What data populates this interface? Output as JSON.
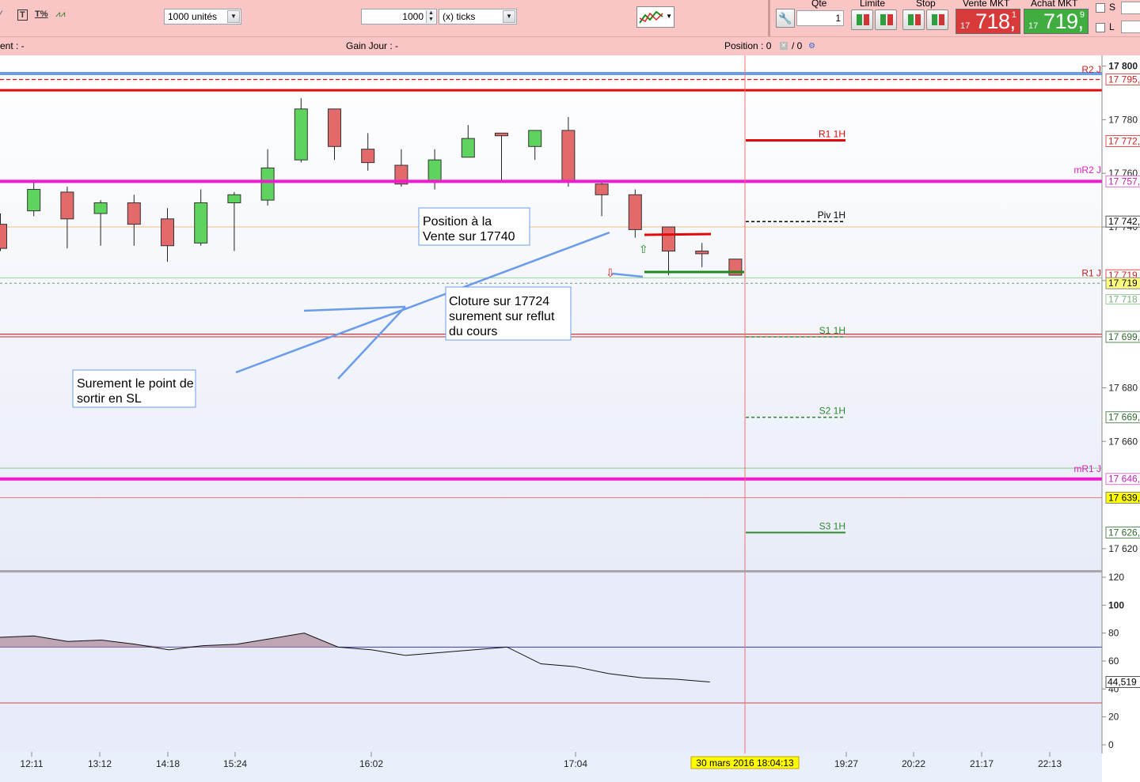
{
  "toolbar": {
    "quantity_select": "1000 unités",
    "ticks_value": "1000",
    "ticks_unit": "(x) ticks",
    "qte_label": "Qte",
    "qte_value": "1",
    "limite_label": "Limite",
    "stop_label": "Stop",
    "vente_label": "Vente MKT",
    "vente_prefix": "17",
    "vente_price": "718,",
    "vente_decimal": "1",
    "achat_label": "Achat MKT",
    "achat_prefix": "17",
    "achat_price": "719,",
    "achat_decimal": "9",
    "s_label": "S",
    "l_label": "L"
  },
  "infobar": {
    "left": "ent : -",
    "gain": "Gain Jour : -",
    "position": "Position : 0",
    "position2": "/ 0"
  },
  "colors": {
    "bull": "#5ed45e",
    "bear": "#e26a6a",
    "magenta": "#ee1bd0",
    "red": "#e00a0a",
    "blue": "#6b9cec",
    "green": "#2e8a2e"
  },
  "chart_data": {
    "type": "candlestick",
    "price_axis": {
      "ylim": [
        17612,
        17804
      ],
      "ticks": [
        "17 800",
        "17 780",
        "17 760",
        "17 740",
        "17 720",
        "17 680",
        "17 660",
        "17 620"
      ]
    },
    "time_axis": {
      "ticks": [
        "12:11",
        "13:12",
        "14:18",
        "15:24",
        "16:02",
        "17:04",
        "19:27",
        "20:22",
        "21:17",
        "22:13"
      ],
      "cursor_label": "30 mars 2016 18:04:13"
    },
    "candles": [
      {
        "o": 17741,
        "c": 17732,
        "h": 17745,
        "l": 17731
      },
      {
        "o": 17746,
        "c": 17754,
        "h": 17757,
        "l": 17744
      },
      {
        "o": 17753,
        "c": 17743,
        "h": 17755,
        "l": 17732
      },
      {
        "o": 17745,
        "c": 17749,
        "h": 17750,
        "l": 17733
      },
      {
        "o": 17749,
        "c": 17741,
        "h": 17752,
        "l": 17733
      },
      {
        "o": 17743,
        "c": 17733,
        "h": 17747,
        "l": 17727
      },
      {
        "o": 17734,
        "c": 17749,
        "h": 17754,
        "l": 17733
      },
      {
        "o": 17749,
        "c": 17752,
        "h": 17753,
        "l": 17731
      },
      {
        "o": 17750,
        "c": 17762,
        "h": 17769,
        "l": 17748
      },
      {
        "o": 17765,
        "c": 17784,
        "h": 17788,
        "l": 17764
      },
      {
        "o": 17784,
        "c": 17770,
        "h": 17784,
        "l": 17765
      },
      {
        "o": 17769,
        "c": 17764,
        "h": 17775,
        "l": 17761
      },
      {
        "o": 17763,
        "c": 17756,
        "h": 17769,
        "l": 17755
      },
      {
        "o": 17757,
        "c": 17765,
        "h": 17769,
        "l": 17754
      },
      {
        "o": 17766,
        "c": 17773,
        "h": 17778,
        "l": 17766
      },
      {
        "o": 17775,
        "c": 17774,
        "h": 17775,
        "l": 17757
      },
      {
        "o": 17770,
        "c": 17776,
        "h": 17776,
        "l": 17765
      },
      {
        "o": 17776,
        "c": 17757,
        "h": 17781,
        "l": 17755
      },
      {
        "o": 17756,
        "c": 17752,
        "h": 17757,
        "l": 17744
      },
      {
        "o": 17752,
        "c": 17739,
        "h": 17754,
        "l": 17736
      },
      {
        "o": 17740,
        "c": 17731,
        "h": 17740,
        "l": 17722
      },
      {
        "o": 17731,
        "c": 17730,
        "h": 17734,
        "l": 17725
      },
      {
        "o": 17728,
        "c": 17722,
        "h": 17728,
        "l": 17722
      }
    ],
    "levels": [
      {
        "label": "R2 J",
        "value": 17795,
        "tag": "17 795,"
      },
      {
        "label": "mR2 J",
        "value": 17757,
        "tag": "17 757,"
      },
      {
        "label": "R1 J",
        "value": 17719,
        "tag": "17 719,"
      },
      {
        "label": "mR1 J",
        "value": 17646,
        "tag": "17 646,"
      },
      {
        "label": "",
        "value": 17639,
        "tag": "17 639,"
      },
      {
        "label": "",
        "value": 17699,
        "tag": "17 699,"
      },
      {
        "label": "",
        "value": 17742,
        "tag": "17 742,"
      },
      {
        "label": "",
        "value": 17772,
        "tag": "17 772,"
      },
      {
        "label": "",
        "value": 17669,
        "tag": "17 669,"
      },
      {
        "label": "",
        "value": 17626,
        "tag": "17 626,"
      }
    ],
    "pivots": [
      {
        "label": "R1 1H",
        "value": 17772
      },
      {
        "label": "Piv 1H",
        "value": 17742
      },
      {
        "label": "S1 1H",
        "value": 17699
      },
      {
        "label": "S2 1H",
        "value": 17669
      },
      {
        "label": "S3 1H",
        "value": 17626
      }
    ],
    "current_price": "17 719",
    "under_tag": "17 718",
    "annotations": [
      "Position à la Vente sur 17740",
      "Cloture sur 17724 surement sur reflut du cours",
      "Surement le point de sortir en SL"
    ],
    "indicator": {
      "ylim": [
        0,
        120
      ],
      "ticks": [
        "120",
        "100",
        "80",
        "60",
        "40",
        "20",
        "0"
      ],
      "upper": 70,
      "lower": 30,
      "current": "44,519",
      "values": [
        77,
        78,
        74,
        75,
        72,
        68,
        71,
        72,
        76,
        80,
        70,
        68,
        64,
        66,
        68,
        70,
        58,
        56,
        51,
        48,
        47,
        45
      ]
    }
  }
}
